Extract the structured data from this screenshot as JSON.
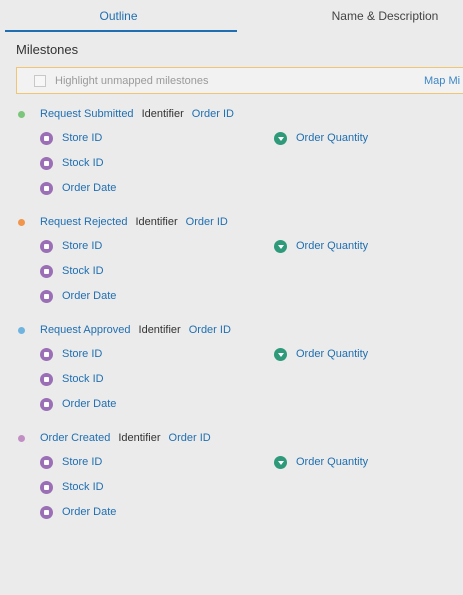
{
  "tabs": {
    "outline": "Outline",
    "name_description": "Name & Description"
  },
  "section_title": "Milestones",
  "highlight": {
    "label": "Highlight unmapped milestones",
    "map_link": "Map Mi"
  },
  "milestones": [
    {
      "name": "Request Submitted",
      "identifier_label": "Identifier",
      "identifier": "Order ID",
      "color": "#7bc67b",
      "fields": [
        "Store ID",
        "Stock ID",
        "Order Date"
      ],
      "metric": "Order Quantity"
    },
    {
      "name": "Request Rejected",
      "identifier_label": "Identifier",
      "identifier": "Order ID",
      "color": "#f0954a",
      "fields": [
        "Store ID",
        "Stock ID",
        "Order Date"
      ],
      "metric": "Order Quantity"
    },
    {
      "name": "Request Approved",
      "identifier_label": "Identifier",
      "identifier": "Order ID",
      "color": "#6fb3e0",
      "fields": [
        "Store ID",
        "Stock ID",
        "Order Date"
      ],
      "metric": "Order Quantity"
    },
    {
      "name": "Order Created",
      "identifier_label": "Identifier",
      "identifier": "Order ID",
      "color": "#c28fc5",
      "fields": [
        "Store ID",
        "Stock ID",
        "Order Date"
      ],
      "metric": "Order Quantity"
    }
  ]
}
